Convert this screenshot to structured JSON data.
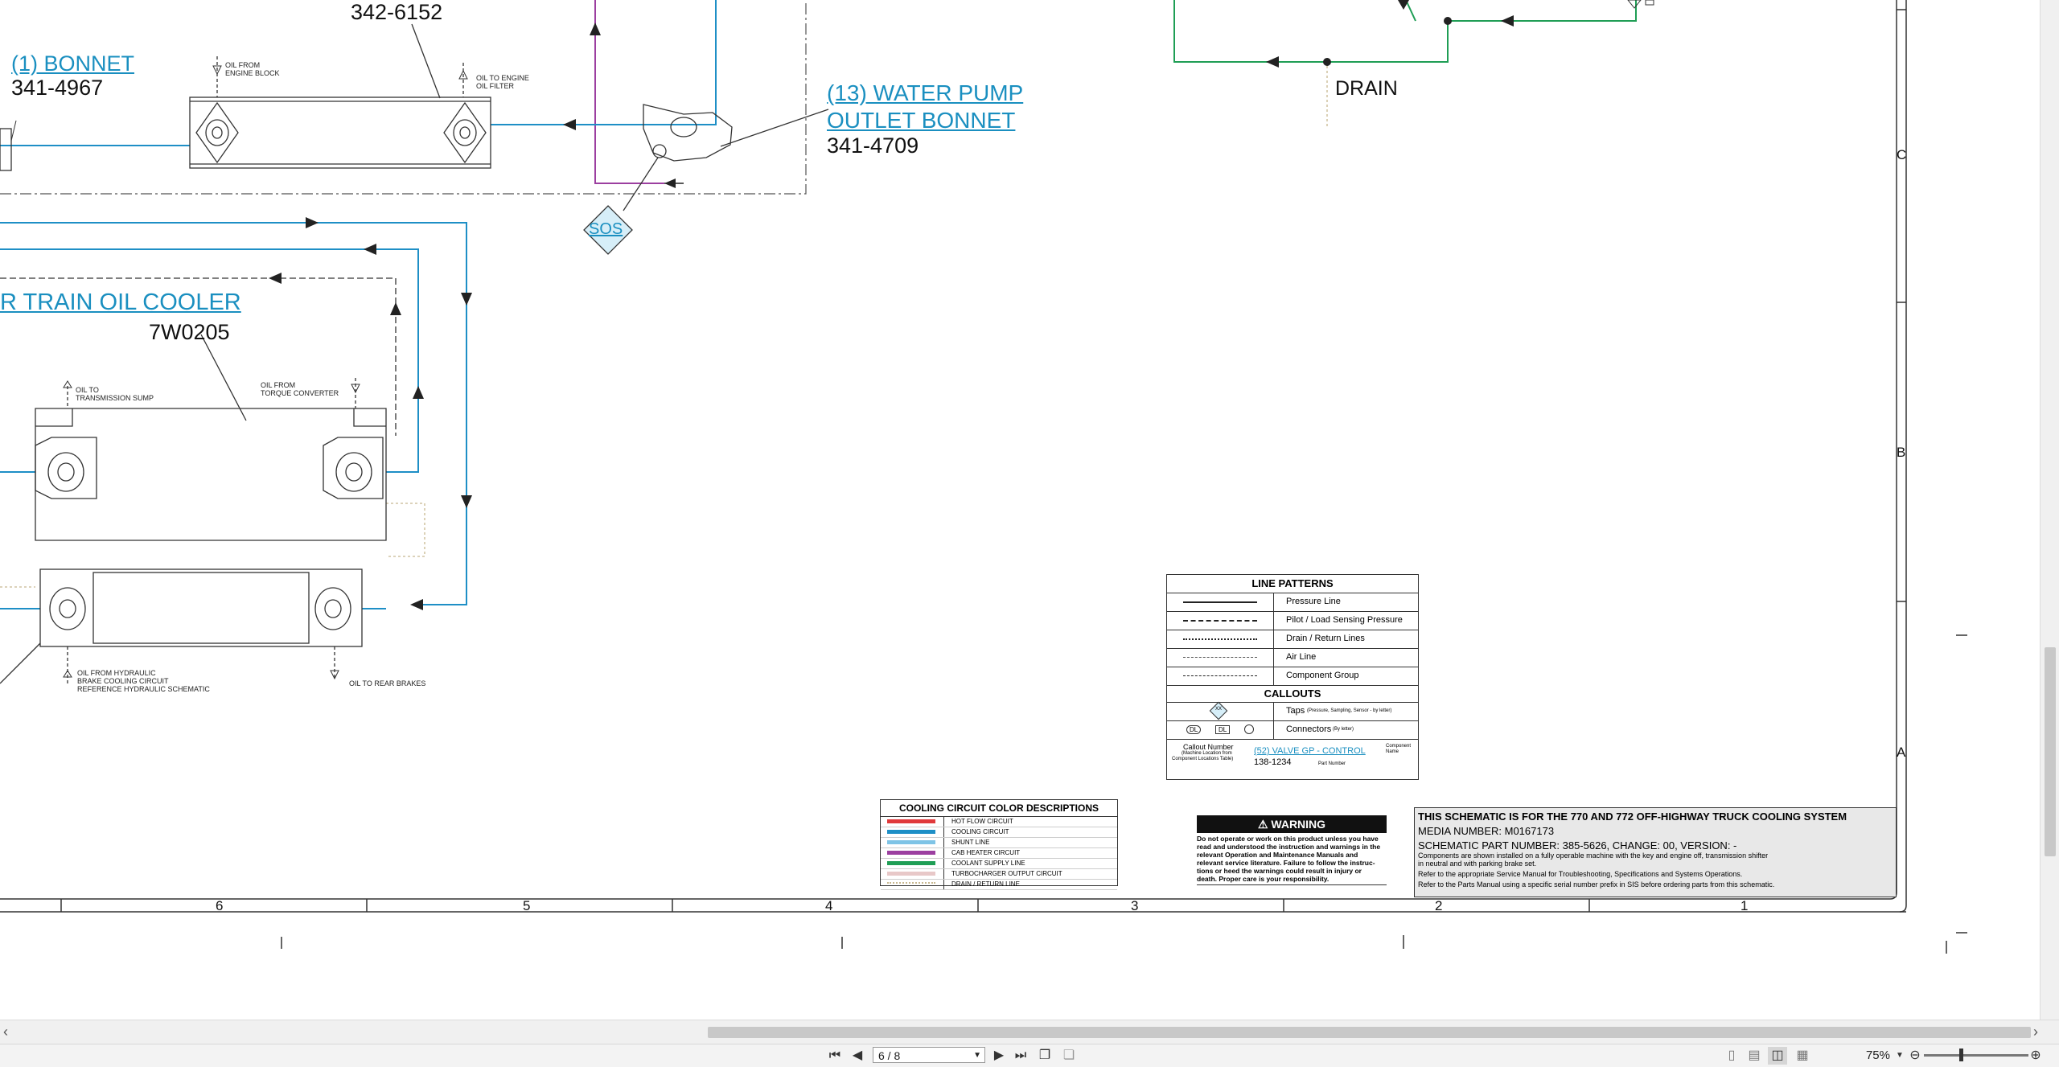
{
  "schematic": {
    "bonnet": {
      "name": "(1) BONNET",
      "part": "341-4967"
    },
    "top_part": "342-6152",
    "water_pump": {
      "name_line1": "(13) WATER PUMP",
      "name_line2": "OUTLET BONNET",
      "part": "341-4709"
    },
    "train_cooler": {
      "name": "R TRAIN OIL COOLER",
      "part": "7W0205"
    },
    "sos_label": "SOS",
    "drain_label": "DRAIN",
    "notes": {
      "oil_from_engine_block": [
        "OIL FROM",
        "ENGINE BLOCK"
      ],
      "oil_to_engine_filter": [
        "OIL TO ENGINE",
        "OIL FILTER"
      ],
      "oil_to_trans_sump": [
        "OIL TO",
        "TRANSMISSION SUMP"
      ],
      "oil_from_torque_conv": [
        "OIL FROM",
        "TORQUE CONVERTER"
      ],
      "oil_from_hydraulic": [
        "OIL FROM HYDRAULIC",
        "BRAKE COOLING CIRCUIT",
        "REFERENCE HYDRAULIC SCHEMATIC"
      ],
      "oil_to_rear_brakes": "OIL TO REAR BRAKES"
    },
    "grid_columns": [
      "6",
      "5",
      "4",
      "3",
      "2",
      "1"
    ],
    "grid_rows": [
      "C",
      "B",
      "A"
    ]
  },
  "legend": {
    "line_patterns_title": "LINE PATTERNS",
    "patterns": [
      "Pressure Line",
      "Pilot / Load Sensing Pressure",
      "Drain / Return Lines",
      "Air Line",
      "Component Group"
    ],
    "callouts_title": "CALLOUTS",
    "taps_label": "Taps",
    "taps_note": "(Pressure, Sampling, Sensor - by letter)",
    "connectors_label": "Connectors",
    "connectors_note": "(By letter)",
    "tap_symbol": "XX",
    "connector_symbols": [
      "DL",
      "DL"
    ],
    "callout_number": "Callout Number",
    "callout_location": [
      "(Machine Location from",
      "Component Locations Table)"
    ],
    "callout_example": "(52) VALVE GP - CONTROL",
    "callout_example_part": "138-1234",
    "component_name": [
      "Component",
      "Name"
    ],
    "part_number": "Part Number"
  },
  "colors": {
    "title": "COOLING CIRCUIT COLOR DESCRIPTIONS",
    "items": [
      {
        "label": "HOT FLOW CIRCUIT",
        "color": "#e0393b"
      },
      {
        "label": "COOLING CIRCUIT",
        "color": "#1e8fc6"
      },
      {
        "label": "SHUNT LINE",
        "color": "#7fc4e6"
      },
      {
        "label": "CAB HEATER CIRCUIT",
        "color": "#9c3fa0"
      },
      {
        "label": "COOLANT SUPPLY LINE",
        "color": "#1f9e55"
      },
      {
        "label": "TURBOCHARGER OUTPUT CIRCUIT",
        "color": "#e8c8c8"
      },
      {
        "label": "DRAIN / RETURN LINE",
        "color": "#c8b890"
      }
    ]
  },
  "warning": {
    "title": "WARNING",
    "text": [
      "Do not operate or work on this product unless you have",
      "read and understood the instruction and warnings in the",
      "relevant Operation and Maintenance Manuals and",
      "relevant service literature. Failure to follow the instruc-",
      "tions or heed the warnings could result in injury or",
      "death. Proper care is your responsibility."
    ]
  },
  "titleblock": {
    "heading": "THIS SCHEMATIC IS FOR THE 770 AND 772 OFF-HIGHWAY TRUCK COOLING SYSTEM",
    "media": "MEDIA NUMBER: M0167173",
    "part": "SCHEMATIC PART NUMBER: 385-5626, CHANGE: 00, VERSION: -",
    "note1a": "Components are shown installed on a fully operable machine with the key and engine off, transmission shifter",
    "note1b": "in neutral and with parking brake set.",
    "note2": "Refer to the appropriate Service Manual for Troubleshooting, Specifications and Systems Operations.",
    "note3": "Refer to the Parts Manual using a specific serial number prefix in SIS before ordering parts from this schematic."
  },
  "viewer": {
    "page_indicator": "6 / 8",
    "zoom": "75%",
    "icons": [
      "first-page-icon",
      "prev-page-icon",
      "next-page-icon",
      "last-page-icon",
      "page-thumbnails-icon",
      "page-copy-icon",
      "single-page-icon",
      "single-continuous-icon",
      "two-page-icon",
      "two-continuous-icon",
      "zoom-out-icon",
      "zoom-in-icon"
    ]
  }
}
